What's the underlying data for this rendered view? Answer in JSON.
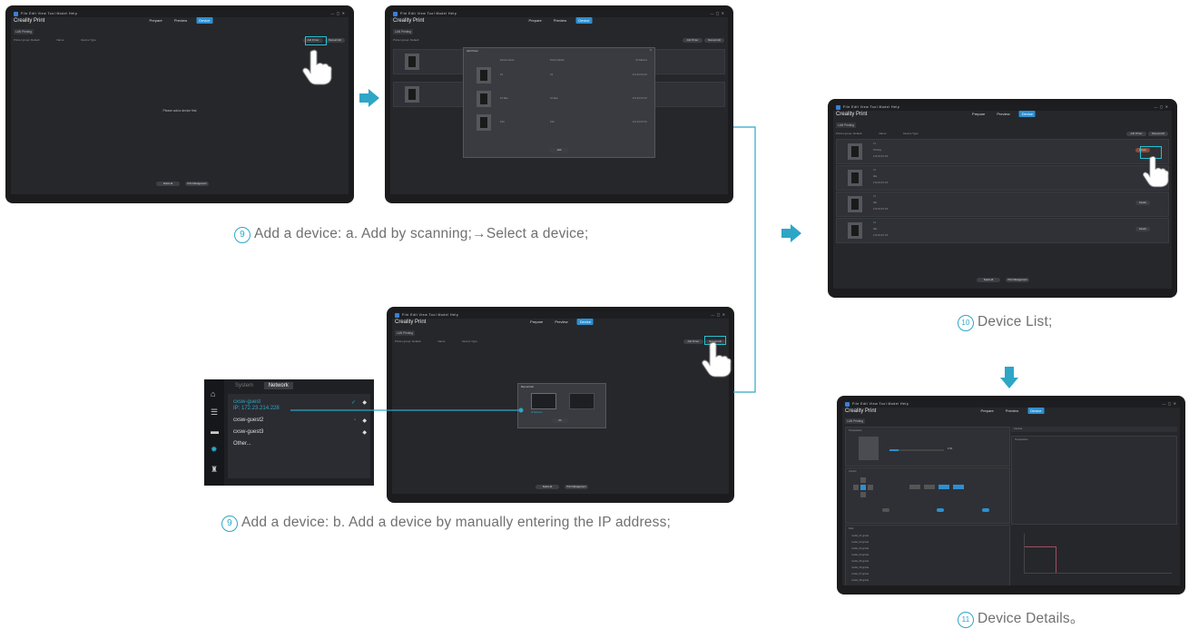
{
  "captions": {
    "c1_num": "9",
    "c1_text": "Add a device: a. Add by scanning;→Select a device;",
    "c2_num": "9",
    "c2_text": "Add a device: b. Add a device by manually entering the IP address;",
    "c3_num": "10",
    "c3_text": "Device List;",
    "c4_num": "11",
    "c4_text": "Device Details。"
  },
  "app": {
    "title": "Creality Print",
    "menus": "File  Edit  View  Tool  Model  Help",
    "tabs": [
      "Prepare",
      "Preview",
      "Device"
    ],
    "subtab": "LAN Printing",
    "empty_msg": "Please add a device first",
    "btn_add_scan": "Add Printer",
    "btn_add_manual": "Manual Add",
    "btn_bottom1": "Select all",
    "btn_bottom2": "Print Management",
    "filter_group": "Printer group: Default",
    "filter_name": "Name",
    "filter_type": "Device Type"
  },
  "scan_dialog": {
    "title": "Add Printer",
    "col_name": "Device Name",
    "col_model": "Printer Model",
    "col_ip": "IP Address",
    "rows": [
      {
        "name": "K1",
        "model": "K1",
        "ip": "172.16.XX.XX"
      },
      {
        "name": "K1 Max",
        "model": "K1 Max",
        "ip": "172.16.XX.XX"
      },
      {
        "name": "K1C",
        "model": "K1C",
        "ip": "172.16.XX.XX"
      }
    ],
    "ok": "Add"
  },
  "manual_dialog": {
    "title": "Manual Add",
    "ip_label": "IP Address",
    "ok": "OK"
  },
  "network_panel": {
    "tabs": [
      "System",
      "Network"
    ],
    "items": [
      {
        "ssid": "cxsw-guest",
        "ip": "IP: 172.23.214.228"
      },
      {
        "ssid": "cxsw-guest2"
      },
      {
        "ssid": "cxsw-guest3"
      },
      {
        "ssid": "Other..."
      }
    ],
    "colors": {
      "accent": "#2ea6c6",
      "bg": "#1e2024"
    }
  },
  "device_list": {
    "rows": [
      {
        "name": "K1",
        "status": "Printing",
        "ip": "172.23.XX.XX"
      },
      {
        "name": "K1",
        "status": "Idle",
        "ip": "172.23.XX.XX"
      },
      {
        "name": "K1",
        "status": "Idle",
        "ip": "172.23.XX.XX"
      },
      {
        "name": "K1",
        "status": "Idle",
        "ip": "172.23.XX.XX"
      }
    ],
    "detail_btn": "Details"
  },
  "device_details": {
    "panel_temp": "Temperature",
    "panel_ctrl": "Control",
    "panel_files": "Files",
    "panel_camera": "Camera",
    "progress_pct": "17%",
    "chart_title": "Temperature",
    "file_rows": [
      "model_01.gcode",
      "model_02.gcode",
      "model_03.gcode",
      "model_04.gcode",
      "model_05.gcode",
      "model_06.gcode",
      "model_07.gcode",
      "model_08.gcode"
    ]
  },
  "colors": {
    "accent": "#2d8fd1",
    "arrow": "#2ea6c6",
    "highlight": "#27c1d3"
  }
}
